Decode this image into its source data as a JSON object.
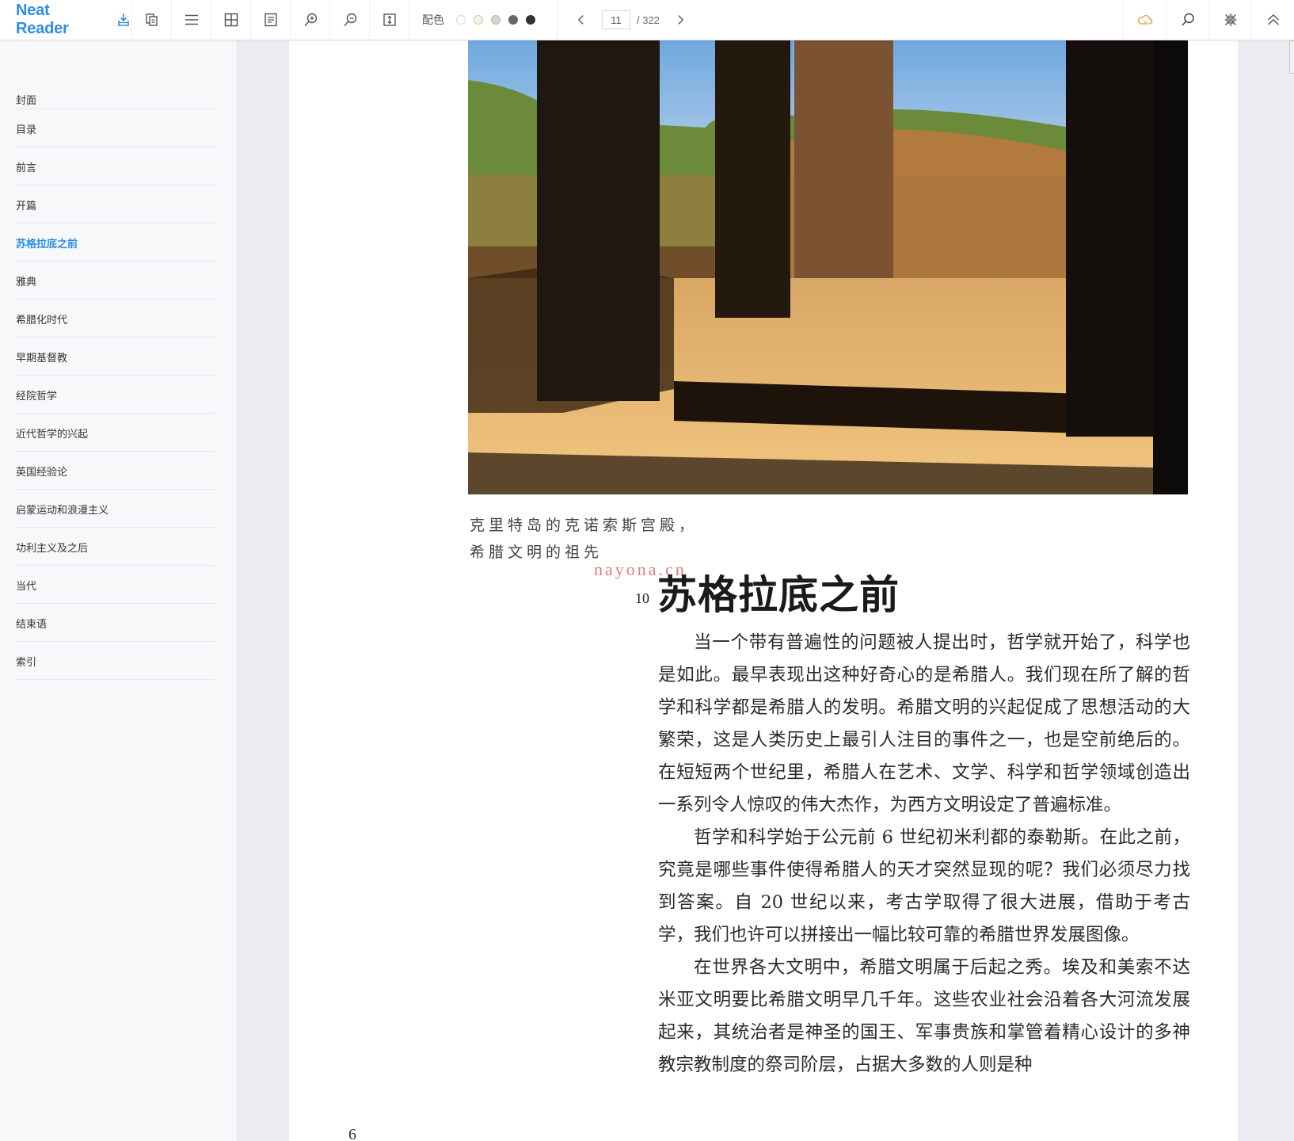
{
  "app": {
    "title": "Neat Reader",
    "brand_color": "#2e8ee6"
  },
  "toolbar": {
    "buttons": [
      {
        "name": "import-button",
        "icon": "import-icon"
      },
      {
        "name": "library-button",
        "icon": "copy-icon"
      },
      {
        "name": "toc-button",
        "icon": "menu-icon"
      },
      {
        "name": "layout-button",
        "icon": "grid-icon"
      },
      {
        "name": "notes-button",
        "icon": "document-icon"
      },
      {
        "name": "zoom-in-button",
        "icon": "zoom-in-icon"
      },
      {
        "name": "zoom-out-button",
        "icon": "zoom-out-icon"
      },
      {
        "name": "fit-height-button",
        "icon": "fit-height-icon"
      }
    ],
    "palette": {
      "label": "配色",
      "swatches": [
        "#ffffff",
        "#f5f3e6",
        "#d6d6c8",
        "#666666",
        "#333333"
      ]
    },
    "pager": {
      "current": "11",
      "total": "/ 322"
    },
    "right_buttons": [
      {
        "name": "cloud-sync-button",
        "icon": "cloud-icon",
        "color": "#e89a4a"
      },
      {
        "name": "search-button",
        "icon": "search-icon"
      },
      {
        "name": "collapse-button",
        "icon": "compress-icon"
      },
      {
        "name": "scroll-top-button",
        "icon": "double-chevron-up-icon"
      }
    ]
  },
  "sidebar": {
    "items": [
      {
        "label": "封面",
        "active": false
      },
      {
        "label": "目录",
        "active": false
      },
      {
        "label": "前言",
        "active": false
      },
      {
        "label": "开篇",
        "active": false
      },
      {
        "label": "苏格拉底之前",
        "active": true
      },
      {
        "label": "雅典",
        "active": false
      },
      {
        "label": "希腊化时代",
        "active": false
      },
      {
        "label": "早期基督教",
        "active": false
      },
      {
        "label": "经院哲学",
        "active": false
      },
      {
        "label": "近代哲学的兴起",
        "active": false
      },
      {
        "label": "英国经验论",
        "active": false
      },
      {
        "label": "启蒙运动和浪漫主义",
        "active": false
      },
      {
        "label": "功利主义及之后",
        "active": false
      },
      {
        "label": "当代",
        "active": false
      },
      {
        "label": "结束语",
        "active": false
      },
      {
        "label": "索引",
        "active": false
      }
    ]
  },
  "page": {
    "caption_lines": [
      "克里特岛的克诺索斯宫殿，",
      "希腊文明的祖先"
    ],
    "watermark": "nayona.cn",
    "chapter_number": "10",
    "chapter_title": "苏格拉底之前",
    "paragraphs": [
      "当一个带有普遍性的问题被人提出时，哲学就开始了，科学也是如此。最早表现出这种好奇心的是希腊人。我们现在所了解的哲学和科学都是希腊人的发明。希腊文明的兴起促成了思想活动的大繁荣，这是人类历史上最引人注目的事件之一，也是空前绝后的。在短短两个世纪里，希腊人在艺术、文学、科学和哲学领域创造出一系列令人惊叹的伟大杰作，为西方文明设定了普遍标准。",
      "哲学和科学始于公元前 6 世纪初米利都的泰勒斯。在此之前，究竟是哪些事件使得希腊人的天才突然显现的呢？我们必须尽力找到答案。自 20 世纪以来，考古学取得了很大进展，借助于考古学，我们也许可以拼接出一幅比较可靠的希腊世界发展图像。",
      "在世界各大文明中，希腊文明属于后起之秀。埃及和美索不达米亚文明要比希腊文明早几千年。这些农业社会沿着各大河流发展起来，其统治者是神圣的国王、军事贵族和掌管着精心设计的多神教宗教制度的祭司阶层，占据大多数的人则是种"
    ],
    "folio": "6"
  }
}
